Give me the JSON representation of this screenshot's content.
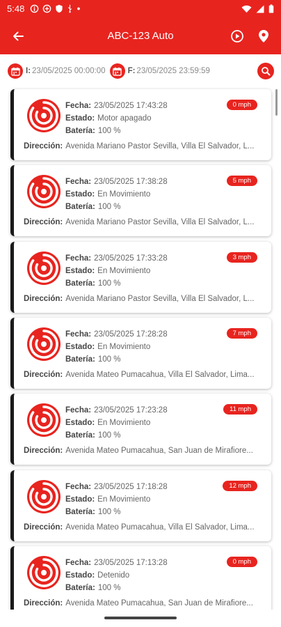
{
  "status_bar": {
    "time": "5:48",
    "icons": [
      "info-icon",
      "vpn-icon",
      "shield-icon",
      "usb-icon",
      "dot-icon",
      "wifi-icon",
      "signal-icon",
      "battery-icon"
    ]
  },
  "app_bar": {
    "title": "ABC-123 Auto",
    "back_icon": "arrow-left-icon",
    "actions": [
      "play-circle-icon",
      "location-pin-icon"
    ]
  },
  "filter": {
    "start_label": "I:",
    "start_value": "23/05/2025 00:00:00",
    "end_label": "F:",
    "end_value": "23/05/2025 23:59:59"
  },
  "labels": {
    "fecha": "Fecha:",
    "estado": "Estado:",
    "bateria": "Batería:",
    "direccion": "Dirección:"
  },
  "records": [
    {
      "fecha": "23/05/2025 17:43:28",
      "estado": "Motor apagado",
      "bateria": "100 %",
      "speed": "0 mph",
      "direccion": "Avenida Mariano Pastor Sevilla, Villa El Salvador, L..."
    },
    {
      "fecha": "23/05/2025 17:38:28",
      "estado": "En Movimiento",
      "bateria": "100 %",
      "speed": "5 mph",
      "direccion": "Avenida Mariano Pastor Sevilla, Villa El Salvador, L..."
    },
    {
      "fecha": "23/05/2025 17:33:28",
      "estado": "En Movimiento",
      "bateria": "100 %",
      "speed": "3 mph",
      "direccion": "Avenida Mariano Pastor Sevilla, Villa El Salvador, L..."
    },
    {
      "fecha": "23/05/2025 17:28:28",
      "estado": "En Movimiento",
      "bateria": "100 %",
      "speed": "7 mph",
      "direccion": "Avenida Mateo Pumacahua, Villa El Salvador, Lima..."
    },
    {
      "fecha": "23/05/2025 17:23:28",
      "estado": "En Movimiento",
      "bateria": "100 %",
      "speed": "11 mph",
      "direccion": "Avenida Mateo Pumacahua, San Juan de Mirafiore..."
    },
    {
      "fecha": "23/05/2025 17:18:28",
      "estado": "En Movimiento",
      "bateria": "100 %",
      "speed": "12 mph",
      "direccion": "Avenida Mateo Pumacahua, Villa El Salvador, Lima..."
    },
    {
      "fecha": "23/05/2025 17:13:28",
      "estado": "Detenido",
      "bateria": "100 %",
      "speed": "0 mph",
      "direccion": "Avenida Mateo Pumacahua, San Juan de Mirafiore..."
    }
  ],
  "colors": {
    "accent": "#e8241f",
    "card_border": "#1a1a1a"
  }
}
